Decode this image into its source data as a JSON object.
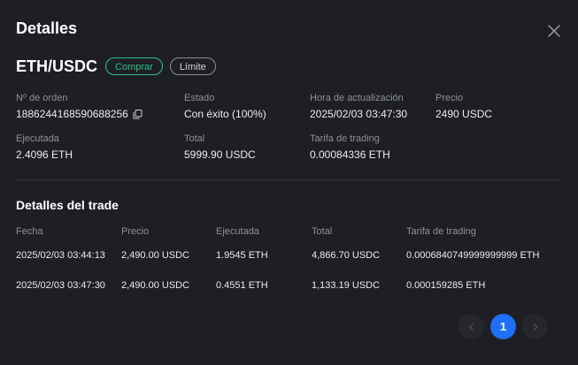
{
  "modal": {
    "title": "Detalles",
    "close_icon": "close-icon"
  },
  "order": {
    "pair": "ETH/USDC",
    "side": "Comprar",
    "type": "Límite",
    "order_no_label": "Nº de orden",
    "order_no_value": "1886244168590688256",
    "status_label": "Estado",
    "status_value": "Con éxito (100%)",
    "update_label": "Hora de actualización",
    "update_value": "2025/02/03 03:47:30",
    "price_label": "Precio",
    "price_value": "2490 USDC",
    "executed_label": "Ejecutada",
    "executed_value": "2.4096 ETH",
    "total_label": "Total",
    "total_value": "5999.90 USDC",
    "fee_label": "Tarifa de trading",
    "fee_value": "0.00084336 ETH"
  },
  "trades": {
    "title": "Detalles del trade",
    "headers": [
      "Fecha",
      "Precio",
      "Ejecutada",
      "Total",
      "Tarifa de trading"
    ],
    "rows": [
      [
        "2025/02/03 03:44:13",
        "2,490.00 USDC",
        "1.9545 ETH",
        "4,866.70 USDC",
        "0.0006840749999999999 ETH"
      ],
      [
        "2025/02/03 03:47:30",
        "2,490.00 USDC",
        "0.4551 ETH",
        "1,133.19 USDC",
        "0.000159285 ETH"
      ]
    ]
  },
  "pagination": {
    "current": "1"
  },
  "colors": {
    "background": "#1e1f24",
    "buy": "#2ebd85",
    "accent": "#1f6fff"
  }
}
